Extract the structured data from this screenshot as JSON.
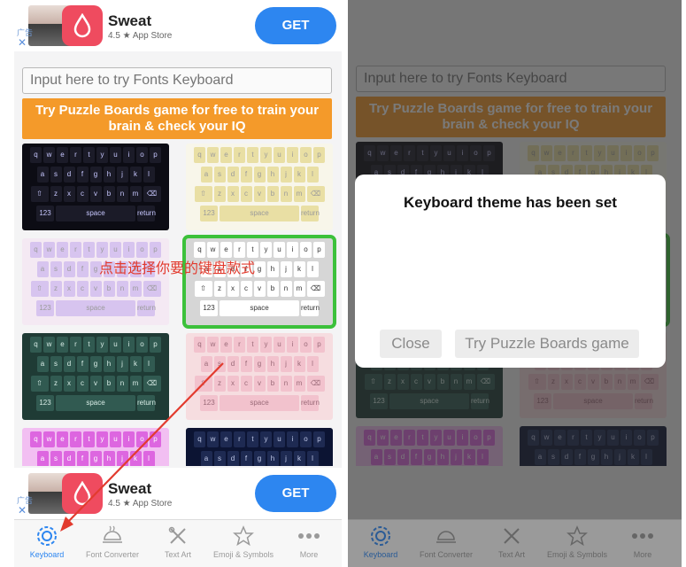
{
  "ad": {
    "title": "Sweat",
    "rating": "4.5 ★ App Store",
    "get_label": "GET",
    "ad_mark": "广告",
    "close_glyph": "✕"
  },
  "input": {
    "placeholder": "Input here to try Fonts Keyboard"
  },
  "promo": {
    "text": "Try Puzzle Boards game for free to train your brain & check your IQ"
  },
  "annotation": {
    "text": "点击选择你要的键盘款式"
  },
  "keyboard_labels": {
    "space": "space",
    "numbers": "123",
    "return": "return"
  },
  "tabs": [
    {
      "label": "Keyboard",
      "icon": "gear-icon",
      "active": true
    },
    {
      "label": "Font Converter",
      "icon": "serving-dish-icon",
      "active": false
    },
    {
      "label": "Text Art",
      "icon": "crossed-tools-icon",
      "active": false
    },
    {
      "label": "Emoji & Symbols",
      "icon": "star-icon",
      "active": false
    },
    {
      "label": "More",
      "icon": "more-dots-icon",
      "active": false
    }
  ],
  "dialog": {
    "title": "Keyboard theme has been set",
    "close_label": "Close",
    "try_label": "Try Puzzle Boards game"
  },
  "colors": {
    "accent": "#2d86f0",
    "promo": "#f49a2a",
    "selected_outline": "#3cc13b",
    "annotation": "#e23b2e"
  },
  "keyboard_themes": [
    {
      "name": "black",
      "bg": "#0c0c14",
      "key": "#1b1b28",
      "text": "#c8c8ff"
    },
    {
      "name": "pastel-light",
      "bg": "#f8f6ea",
      "key": "#e9dfa4",
      "text": "#9a9a9a"
    },
    {
      "name": "pastel-pink",
      "bg": "#f4e9f3",
      "key": "#d7c4ef",
      "text": "#9a9a9a"
    },
    {
      "name": "white",
      "bg": "#d6d6d6",
      "key": "#ffffff",
      "text": "#333333"
    },
    {
      "name": "dark-green",
      "bg": "#1f3b35",
      "key": "#315a51",
      "text": "#d8ece6"
    },
    {
      "name": "light-pink",
      "bg": "#f6dde0",
      "key": "#f2c2cd",
      "text": "#9a6a78"
    },
    {
      "name": "magenta",
      "bg": "#f2bff2",
      "key": "#dd66e0",
      "text": "#ffffff"
    },
    {
      "name": "navy",
      "bg": "#0c1433",
      "key": "#1e2a52",
      "text": "#c0c8e8"
    }
  ]
}
